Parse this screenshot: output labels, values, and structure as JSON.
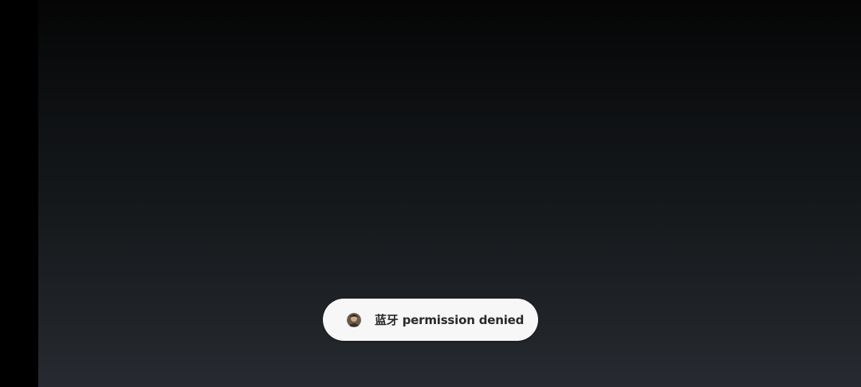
{
  "toast": {
    "message": "蓝牙 permission denied",
    "icon": "app-avatar-icon"
  },
  "colors": {
    "toast_background": "#f7f7f7",
    "toast_text": "#2a2a2a",
    "background_top": "#050505",
    "background_bottom": "#272a30"
  }
}
